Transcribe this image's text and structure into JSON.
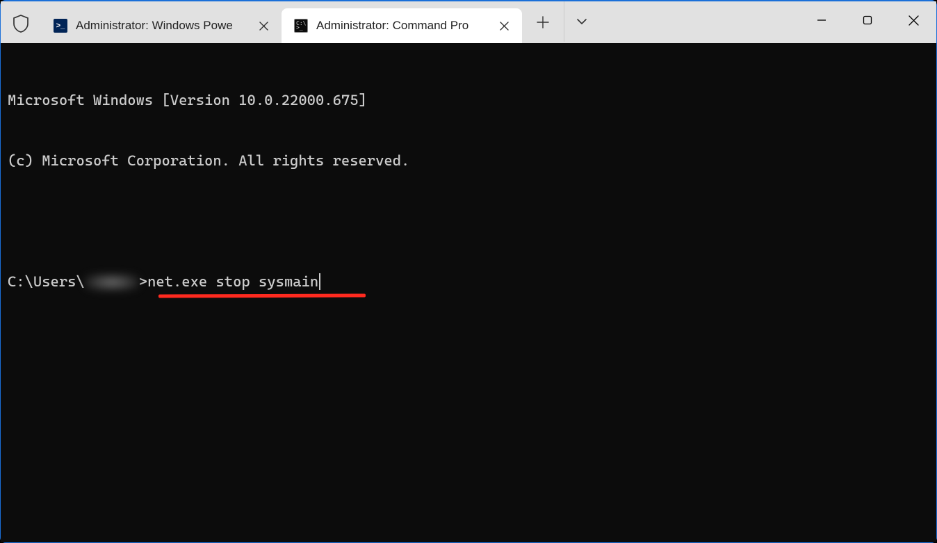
{
  "titlebar": {
    "tabs": [
      {
        "label": "Administrator: Windows Powe",
        "icon": "powershell-icon",
        "active": false
      },
      {
        "label": "Administrator: Command Pro",
        "icon": "cmd-icon",
        "active": true
      }
    ],
    "newtab": "+",
    "dropdown": "v",
    "minimize": "—",
    "maximize": "▢",
    "close": "✕"
  },
  "terminal": {
    "line1": "Microsoft Windows [Version 10.0.22000.675]",
    "line2": "(c) Microsoft Corporation. All rights reserved.",
    "prompt_prefix": "C:\\Users\\",
    "prompt_suffix": ">",
    "command": "net.exe stop sysmain",
    "underline_color": "#ff2a1f"
  }
}
